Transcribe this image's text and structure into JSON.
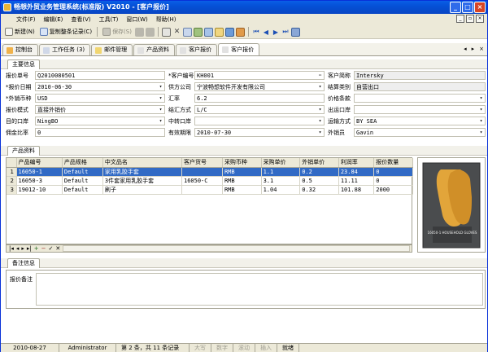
{
  "window": {
    "title": "畅想外贸业务管理系统(标准版) V2010 - [客户报价]",
    "buttons": {
      "minimize": "_",
      "maximize": "□",
      "close": "×"
    }
  },
  "menu": {
    "items": [
      "文件(F)",
      "编辑(E)",
      "查看(V)",
      "工具(T)",
      "窗口(W)",
      "帮助(H)"
    ]
  },
  "toolbar": {
    "new_label": "新建(N)",
    "copy_label": "复制整条记录(C)",
    "save_label": "保存(S)"
  },
  "tabs": [
    {
      "label": "控制台",
      "active": false
    },
    {
      "label": "工作任务 (3)",
      "active": false
    },
    {
      "label": "邮件管理",
      "active": false
    },
    {
      "label": "产品资料",
      "active": false
    },
    {
      "label": "客户报价",
      "active": false
    },
    {
      "label": "客户报价",
      "active": true
    }
  ],
  "sections": {
    "main_info": "主要信息",
    "product_info": "产品资料",
    "remarks": "备注信息"
  },
  "form": {
    "quote_no_label": "报价单号",
    "quote_no": "Q2010080501",
    "customer_code_label": "*客户编号",
    "customer_code": "KH001",
    "customer_short_label": "客户简称",
    "customer_short": "Intersky",
    "quote_date_label": "*报价日期",
    "quote_date": "2010-06-30",
    "supplier_label": "供方公司",
    "supplier": "宁波畅想软件开发有限公司",
    "settle_type_label": "结算类别",
    "settle_type": "自营出口",
    "currency_label": "*外销币种",
    "currency": "USD",
    "rate_label": "汇率",
    "rate": "6.2",
    "price_terms_label": "价格条款",
    "price_terms": "",
    "quote_mode_label": "报价模式",
    "quote_mode": "直接外销价",
    "settle_method_label": "结汇方式",
    "settle_method": "L/C",
    "export_port_label": "出运口岸",
    "export_port": "",
    "dest_port_label": "目的口岸",
    "dest_port": "NingBO",
    "transit_port_label": "中转口岸",
    "transit_port": "",
    "transport_label": "运输方式",
    "transport": "BY SEA",
    "commission_label": "佣金比率",
    "commission": "0",
    "valid_until_label": "有效期限",
    "valid_until": "2010-07-30",
    "sales_rep_label": "外销员",
    "sales_rep": "Gavin"
  },
  "product_table": {
    "columns": [
      "产品编号",
      "产品规格",
      "中文品名",
      "客户货号",
      "采购币种",
      "采购单价",
      "外销单价",
      "利润率",
      "报价数量"
    ],
    "rows": [
      {
        "n": "1",
        "cells": [
          "16050-1",
          "Default",
          "家用乳胶手套",
          "",
          "RMB",
          "1.1",
          "0.2",
          "23.84",
          "0"
        ],
        "selected": true
      },
      {
        "n": "2",
        "cells": [
          "16050-3",
          "Default",
          "3件套家用乳胶手套",
          "16050-C",
          "RMB",
          "3.1",
          "0.5",
          "11.11",
          "0"
        ],
        "selected": false
      },
      {
        "n": "3",
        "cells": [
          "19012-10",
          "Default",
          "刷子",
          "",
          "RMB",
          "1.04",
          "0.32",
          "101.88",
          "2000"
        ],
        "selected": false
      }
    ]
  },
  "product_image": {
    "caption": "16050-1 HOUSEHOLD GLOVES"
  },
  "remarks": {
    "label": "报价备注",
    "value": ""
  },
  "status": {
    "date": "2010-08-27",
    "user": "Administrator",
    "record": "第 2 条，共 11 条记录",
    "caps": "大写",
    "num": "数字",
    "scroll": "滚动",
    "insert": "插入",
    "ready": "就绪"
  },
  "colors": {
    "titlebar": "#0550d6",
    "selection": "#316ac5",
    "glove": "#e2a53a"
  }
}
